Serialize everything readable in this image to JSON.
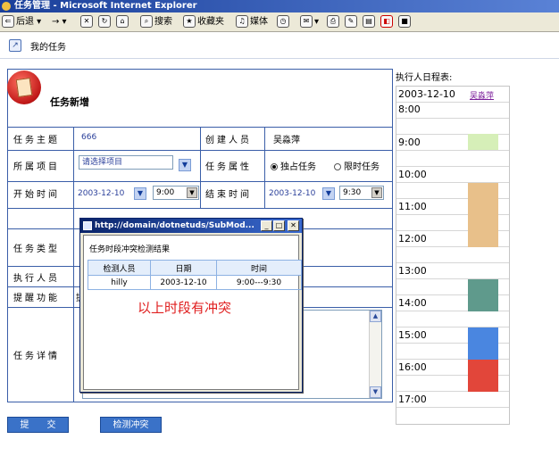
{
  "window": {
    "title": "任务管理 - Microsoft Internet Explorer"
  },
  "ie_toolbar": {
    "back": "后退",
    "search": "搜索",
    "favorites": "收藏夹",
    "media": "媒体"
  },
  "breadcrumb": {
    "label": "我的任务"
  },
  "form": {
    "heading": "任务新增",
    "subject_label": "任务主题",
    "subject_value": "666",
    "creator_label": "创建人员",
    "creator_value": "吴淼萍",
    "project_label": "所属项目",
    "project_value": "请选择项目",
    "attr_label": "任务属性",
    "attr_options": [
      "独占任务",
      "限时任务"
    ],
    "start_label": "开始时间",
    "start_date": "2003-12-10",
    "start_time": "9:00",
    "end_label": "结束时间",
    "end_date": "2003-12-10",
    "end_time": "9:30",
    "type_label": "任务类型",
    "executor_label": "执行人员",
    "remind_label": "提醒功能",
    "remind_value": "提",
    "detail_label": "任务详情"
  },
  "buttons": {
    "submit": "提　　交",
    "check": "检测冲突"
  },
  "popup": {
    "title": "http://domain/dotnetuds/SubMod...",
    "heading": "任务时段冲突检测结果",
    "columns": [
      "检测人员",
      "日期",
      "时间"
    ],
    "rows": [
      {
        "person": "hilly",
        "date": "2003-12-10",
        "time": "9:00---9:30"
      }
    ],
    "message": "以上时段有冲突"
  },
  "schedule": {
    "title": "执行人日程表:",
    "date": "2003-12-10",
    "person": "吴淼萍",
    "hours": [
      "8:00",
      "9:00",
      "10:00",
      "11:00",
      "12:00",
      "13:00",
      "14:00",
      "15:00",
      "16:00",
      "17:00"
    ],
    "colors": {
      "green_light": "#d6efb8",
      "tan": "#e8c08a",
      "teal": "#5f9a8c",
      "blue": "#4a86e0",
      "red": "#e2463a"
    }
  }
}
